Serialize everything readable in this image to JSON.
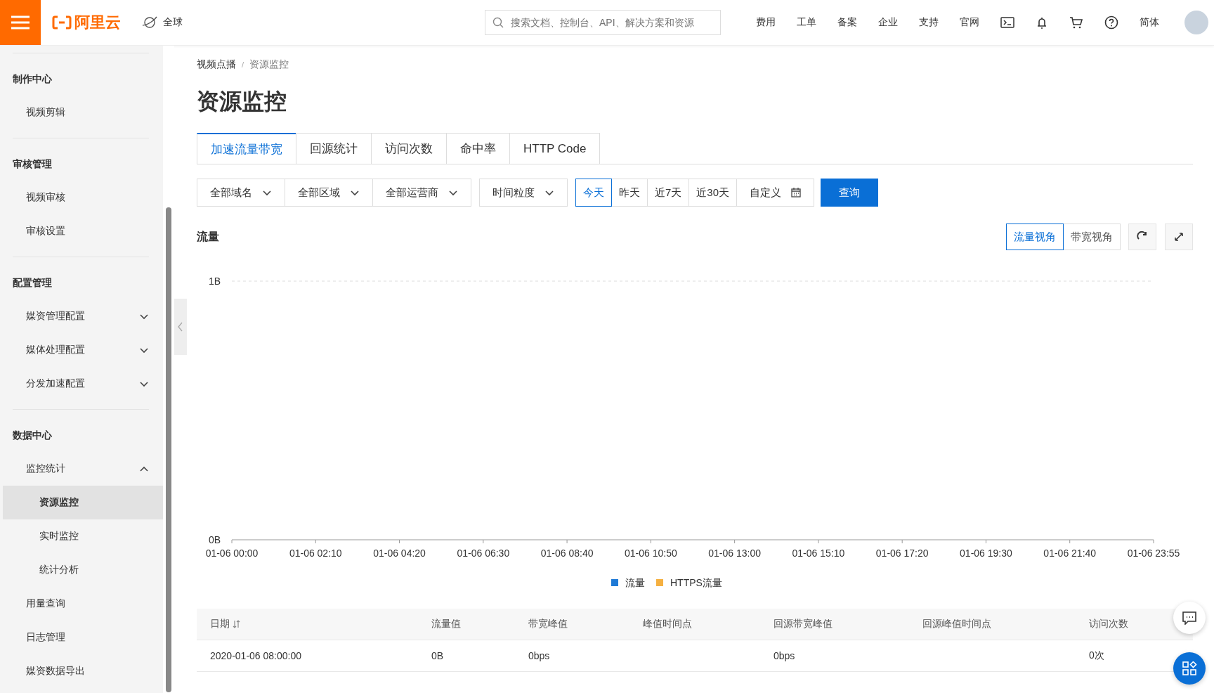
{
  "topbar": {
    "logo": "阿里云",
    "region": "全球",
    "search": {
      "placeholder": "搜索文档、控制台、API、解决方案和资源"
    },
    "links": [
      "费用",
      "工单",
      "备案",
      "企业",
      "支持",
      "官网"
    ],
    "language": "简体"
  },
  "sidebar": {
    "sections": [
      {
        "title": "制作中心",
        "items": [
          {
            "label": "视频剪辑",
            "selected": false
          }
        ]
      },
      {
        "title": "审核管理",
        "items": [
          {
            "label": "视频审核",
            "selected": false
          },
          {
            "label": "审核设置",
            "selected": false
          }
        ]
      },
      {
        "title": "配置管理",
        "items": [
          {
            "label": "媒资管理配置",
            "selected": false,
            "expanded": false
          },
          {
            "label": "媒体处理配置",
            "selected": false,
            "expanded": false
          },
          {
            "label": "分发加速配置",
            "selected": false,
            "expanded": false
          }
        ]
      },
      {
        "title": "数据中心",
        "items": [
          {
            "label": "监控统计",
            "selected": false,
            "expanded": true,
            "children": [
              {
                "label": "资源监控",
                "selected": true
              },
              {
                "label": "实时监控",
                "selected": false
              },
              {
                "label": "统计分析",
                "selected": false
              }
            ]
          },
          {
            "label": "用量查询",
            "selected": false
          },
          {
            "label": "日志管理",
            "selected": false
          },
          {
            "label": "媒资数据导出",
            "selected": false
          }
        ]
      }
    ]
  },
  "breadcrumb": [
    "视频点播",
    "资源监控"
  ],
  "breadcrumb_separator": "/",
  "title": "资源监控",
  "tabs": [
    {
      "label": "加速流量带宽",
      "selected": true
    },
    {
      "label": "回源统计",
      "selected": false
    },
    {
      "label": "访问次数",
      "selected": false
    },
    {
      "label": "命中率",
      "selected": false
    },
    {
      "label": "HTTP Code",
      "selected": false
    }
  ],
  "filters": {
    "dropdowns": [
      "全部域名",
      "全部区域",
      "全部运营商"
    ],
    "granularity": "时间粒度",
    "ranges": [
      {
        "label": "今天",
        "selected": true
      },
      {
        "label": "昨天",
        "selected": false
      },
      {
        "label": "近7天",
        "selected": false
      },
      {
        "label": "近30天",
        "selected": false
      }
    ],
    "custom": "自定义",
    "query_button": "查询"
  },
  "chart_panel": {
    "title": "流量",
    "views": [
      {
        "label": "流量视角",
        "selected": true
      },
      {
        "label": "带宽视角",
        "selected": false
      }
    ],
    "chart_data": {
      "type": "line",
      "categories": [
        "01-06 00:00",
        "01-06 02:10",
        "01-06 04:20",
        "01-06 06:30",
        "01-06 08:40",
        "01-06 10:50",
        "01-06 13:00",
        "01-06 15:10",
        "01-06 17:20",
        "01-06 19:30",
        "01-06 21:40",
        "01-06 23:55"
      ],
      "ylim": [
        0,
        1
      ],
      "yticks": [
        {
          "value": 0,
          "label": "0B"
        },
        {
          "value": 1,
          "label": "1B"
        }
      ],
      "series": [
        {
          "name": "流量",
          "color": "#1f7ad6",
          "values": [
            null,
            null,
            null,
            null,
            null,
            null,
            null,
            null,
            null,
            null,
            null,
            null
          ]
        },
        {
          "name": "HTTPS流量",
          "color": "#f5b041",
          "values": [
            null,
            null,
            null,
            null,
            null,
            null,
            null,
            null,
            null,
            null,
            null,
            null
          ]
        }
      ]
    }
  },
  "table": {
    "columns": [
      "日期",
      "流量值",
      "带宽峰值",
      "峰值时间点",
      "回源带宽峰值",
      "回源峰值时间点",
      "访问次数"
    ],
    "rows": [
      [
        "2020-01-06 08:00:00",
        "0B",
        "0bps",
        "",
        "0bps",
        "",
        "0次"
      ]
    ]
  }
}
